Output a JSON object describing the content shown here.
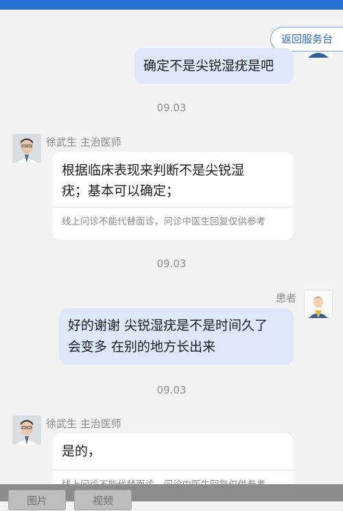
{
  "top_button": "返回服务台",
  "messages": [
    {
      "type": "patient",
      "text": "确定不是尖锐湿疣是吧"
    },
    {
      "type": "time",
      "text": "09.03"
    },
    {
      "type": "doctor",
      "name": "徐武生 主治医师",
      "lines": [
        "根据临床表现来判断不是尖锐湿",
        "疣；基本可以确定；"
      ],
      "disclaimer": "线上问诊不能代替面诊，问诊中医生回复仅供参考"
    },
    {
      "type": "time",
      "text": "09.03"
    },
    {
      "type": "patient",
      "name": "患者",
      "lines": [
        "好的谢谢 尖锐湿疣是不是时间久了",
        "会变多 在别的地方长出来"
      ]
    },
    {
      "type": "time",
      "text": "09.03"
    },
    {
      "type": "doctor",
      "name": "徐武生 主治医师",
      "text": "是的，",
      "disclaimer": "线上问诊不能代替面诊，问诊中医生回复仅供参考"
    }
  ],
  "bottom": {
    "image_label": "图片",
    "video_label": "视频"
  },
  "colors": {
    "accent": "#2a6fd6",
    "patient_bubble": "#dde8fb",
    "background": "#f2f2f2"
  }
}
